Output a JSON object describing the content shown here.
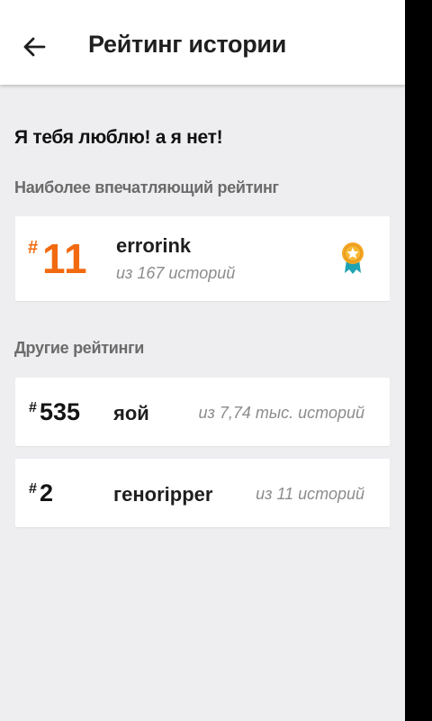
{
  "header": {
    "title": "Рейтинг истории",
    "back_icon": "arrow-left-icon"
  },
  "story": {
    "title": "Я тебя люблю! а я нет!"
  },
  "best_ranking": {
    "section_label": "Наиболее впечатляющий рейтинг",
    "hash": "#",
    "rank": "11",
    "tag": "errorink",
    "subtitle": "из 167 историй",
    "badge_icon": "star-medal-icon",
    "accent_color": "#f26a0f"
  },
  "other_rankings": {
    "section_label": "Другие рейтинги",
    "items": [
      {
        "hash": "#",
        "rank": "535",
        "tag": "яой",
        "subtitle": "из 7,74 тыс. историй"
      },
      {
        "hash": "#",
        "rank": "2",
        "tag": "геноripper",
        "subtitle": "из 11 историй"
      }
    ]
  }
}
